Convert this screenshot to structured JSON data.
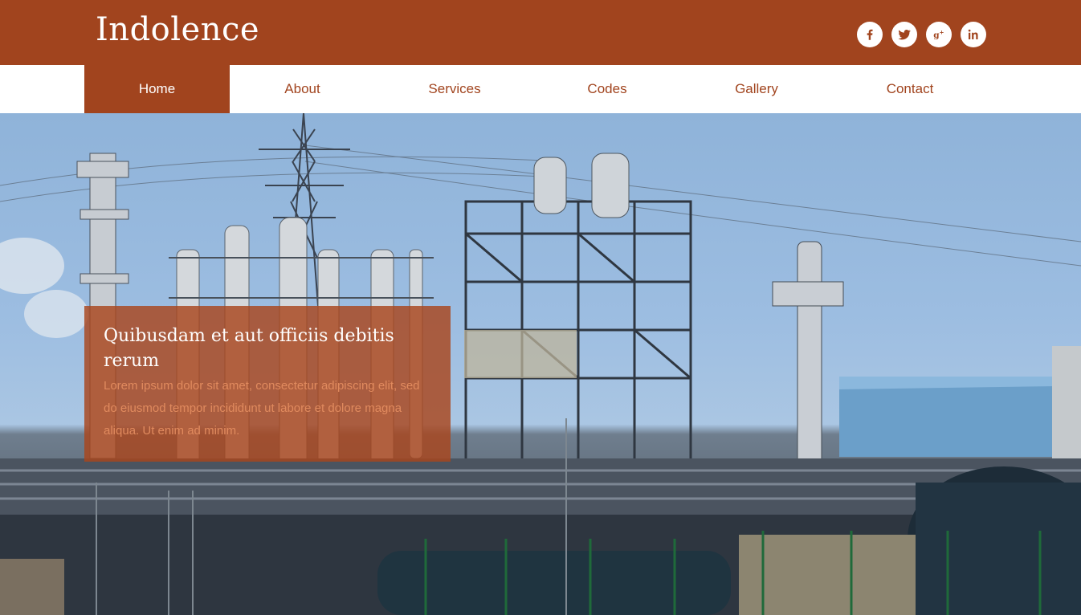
{
  "header": {
    "logo": "Indolence",
    "social": [
      {
        "name": "facebook-icon",
        "glyph": "f"
      },
      {
        "name": "twitter-icon",
        "glyph": ""
      },
      {
        "name": "google-plus-icon",
        "glyph": "g+"
      },
      {
        "name": "linkedin-icon",
        "glyph": "in"
      }
    ]
  },
  "nav": {
    "items": [
      {
        "label": "Home"
      },
      {
        "label": "About"
      },
      {
        "label": "Services"
      },
      {
        "label": "Codes"
      },
      {
        "label": "Gallery"
      },
      {
        "label": "Contact"
      }
    ],
    "active": "Home"
  },
  "hero": {
    "title": "Quibusdam et aut officiis debitis rerum",
    "text": "Lorem ipsum dolor sit amet, consectetur adipiscing elit, sed do eiusmod tempor incididunt ut labore et dolore magna aliqua. Ut enim ad minim."
  },
  "colors": {
    "brand": "#a1441e",
    "white": "#ffffff"
  }
}
